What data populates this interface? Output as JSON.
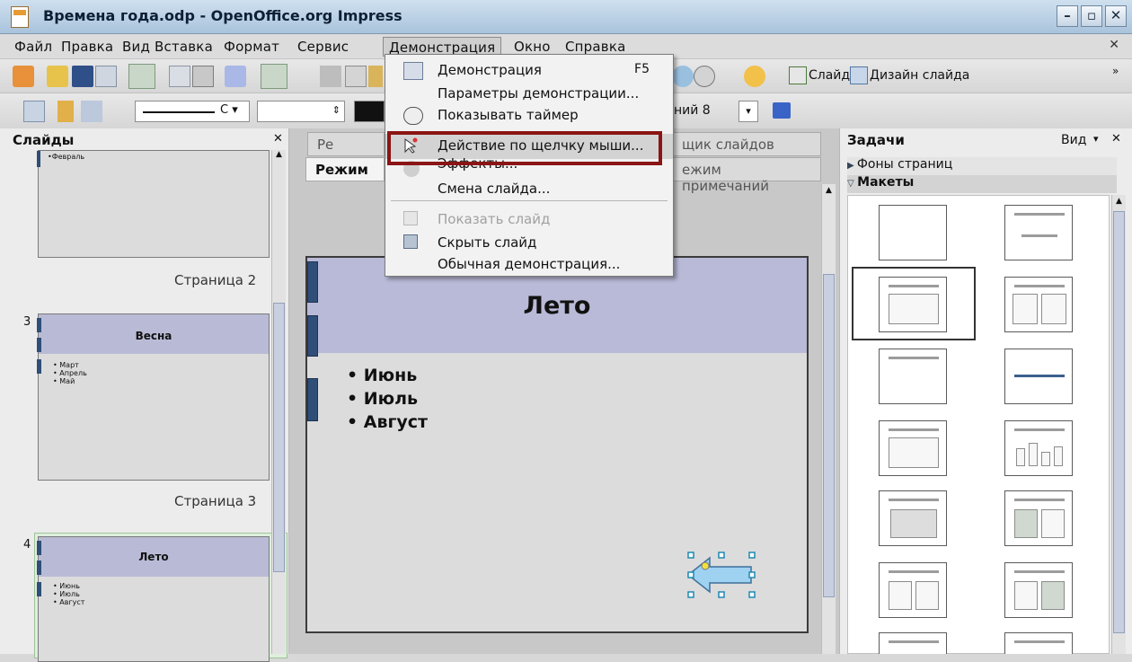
{
  "window": {
    "title": "Времена года.odp - OpenOffice.org Impress"
  },
  "menubar": {
    "items": [
      "Файл",
      "Правка",
      "Вид",
      "Вставка",
      "Формат",
      "Сервис",
      "Демонстрация",
      "Окно",
      "Справка"
    ],
    "open_index": 6
  },
  "toolbar": {
    "slide_label": "Слайд",
    "design_label": "Дизайн слайда",
    "layer_combo": "ний 8"
  },
  "dropdown": {
    "items": [
      {
        "label": "Демонстрация",
        "shortcut": "F5",
        "icon": "presentation-icon",
        "enabled": true
      },
      {
        "label": "Параметры демонстрации...",
        "shortcut": "",
        "icon": "",
        "enabled": true
      },
      {
        "label": "Показывать таймер",
        "shortcut": "",
        "icon": "timer-icon",
        "enabled": true
      },
      {
        "label": "Действие по щелчку мыши...",
        "shortcut": "",
        "icon": "mouse-action-icon",
        "enabled": true,
        "highlighted": true
      },
      {
        "label": "Эффекты...",
        "shortcut": "",
        "icon": "effects-icon",
        "enabled": true
      },
      {
        "label": "Смена слайда...",
        "shortcut": "",
        "icon": "",
        "enabled": true
      },
      {
        "label": "Показать слайд",
        "shortcut": "",
        "icon": "show-slide-icon",
        "enabled": false
      },
      {
        "label": "Скрыть слайд",
        "shortcut": "",
        "icon": "hide-slide-icon",
        "enabled": true
      },
      {
        "label": "Обычная демонстрация...",
        "shortcut": "",
        "icon": "",
        "enabled": true
      }
    ]
  },
  "slides_panel": {
    "title": "Слайды",
    "top_thumb_bullet": "•Февраль",
    "page2_label": "Страница 2",
    "page3_label": "Страница 3",
    "slide3": {
      "num": "3",
      "title": "Весна",
      "bullets": [
        "• Март",
        "• Апрель",
        "• Май"
      ]
    },
    "slide4": {
      "num": "4",
      "title": "Лето",
      "bullets": [
        "• Июнь",
        "• Июль",
        "• Август"
      ]
    }
  },
  "editor": {
    "tabs_row1": [
      "Ре",
      "щик слайдов"
    ],
    "tabs_row2": [
      "Режим ",
      "ежим примечаний"
    ],
    "slide": {
      "title": "Лето",
      "bullets": [
        "• Июнь",
        "• Июль",
        "• Август"
      ]
    }
  },
  "tasks": {
    "title": "Задачи",
    "view_label": "Вид",
    "sections": [
      "Фоны страниц",
      "Макеты"
    ]
  }
}
